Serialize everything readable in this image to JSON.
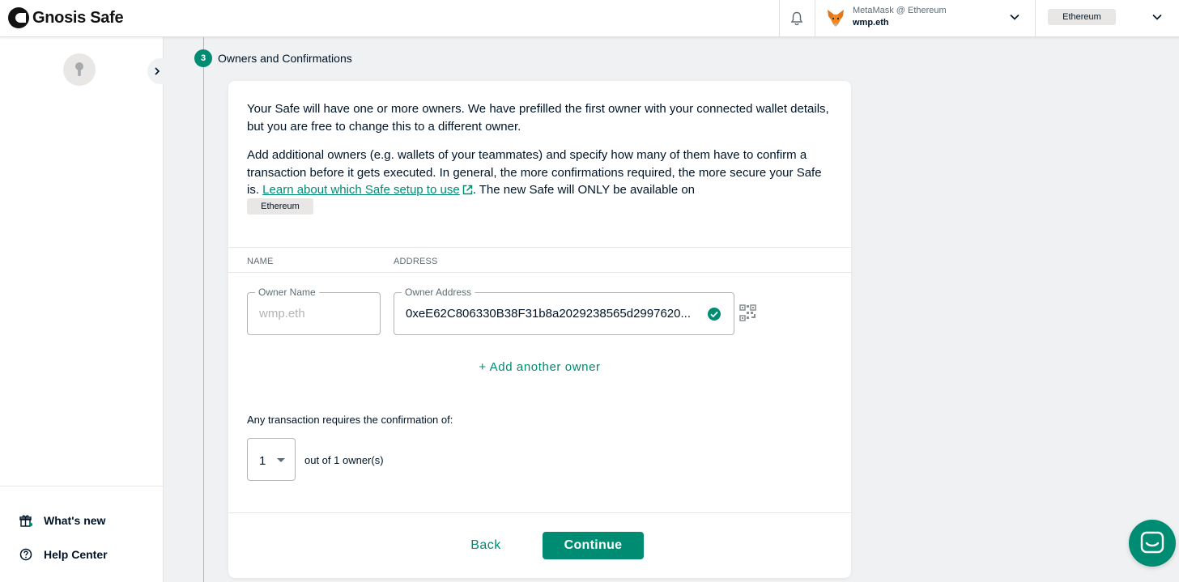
{
  "header": {
    "brand": "Gnosis Safe",
    "wallet_provider": "MetaMask @ Ethereum",
    "wallet_name": "wmp.eth",
    "network": "Ethereum"
  },
  "sidebar": {
    "whats_new": "What's new",
    "help_center": "Help Center"
  },
  "step": {
    "number": "3",
    "title": "Owners and Confirmations"
  },
  "intro": {
    "p1": "Your Safe will have one or more owners. We have prefilled the first owner with your connected wallet details, but you are free to change this to a different owner.",
    "p2_prefix": "Add additional owners (e.g. wallets of your teammates) and specify how many of them have to confirm a transaction before it gets executed. In general, the more confirmations required, the more secure your Safe is. ",
    "p2_link": "Learn about which Safe setup to use",
    "p2_suffix": ". The new Safe will ONLY be available on",
    "network_pill": "Ethereum"
  },
  "owners_table": {
    "col_name": "NAME",
    "col_address": "ADDRESS",
    "owner_name_label": "Owner Name",
    "owner_name_placeholder": "wmp.eth",
    "owner_address_label": "Owner Address",
    "owner_address_value": "0xeE62C806330B38F31b8a2029238565d2997620..."
  },
  "add_owner": "+ Add another owner",
  "threshold": {
    "label": "Any transaction requires the confirmation of:",
    "value": "1",
    "suffix": "out of 1 owner(s)"
  },
  "actions": {
    "back": "Back",
    "continue": "Continue"
  },
  "colors": {
    "accent": "#008c73",
    "text": "#001428",
    "muted": "#5d6d74",
    "border": "#b2b5b2"
  }
}
